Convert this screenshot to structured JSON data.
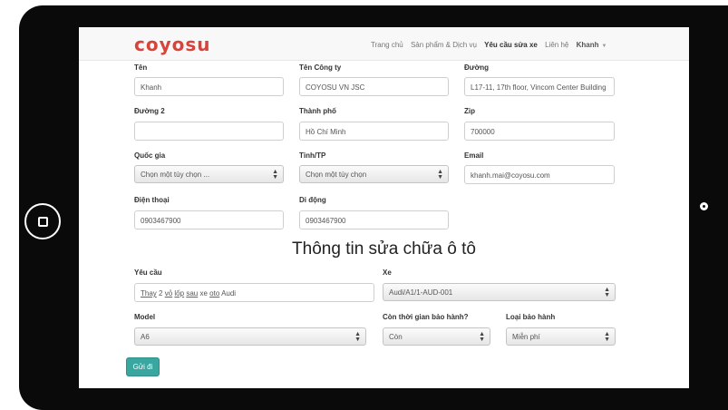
{
  "nav": {
    "logo": "coyosu",
    "links": [
      "Trang chủ",
      "Sản phẩm & Dịch vụ",
      "Yêu cầu sửa xe",
      "Liên hệ"
    ],
    "user": "Khanh"
  },
  "form": {
    "name_label": "Tên",
    "name_value": "Khanh",
    "company_label": "Tên Công ty",
    "company_value": "COYOSU VN JSC",
    "street_label": "Đường",
    "street_value": "L17-11, 17th floor, Vincom Center Building",
    "street2_label": "Đường 2",
    "street2_value": "",
    "city_label": "Thành phố",
    "city_value": "Hồ Chí Minh",
    "zip_label": "Zip",
    "zip_value": "700000",
    "country_label": "Quốc gia",
    "country_value": "Chọn một tùy chọn ...",
    "province_label": "Tỉnh/TP",
    "province_value": "Chọn một tùy chọn",
    "email_label": "Email",
    "email_value": "khanh.mai@coyosu.com",
    "phone_label": "Điện thoại",
    "phone_value": "0903467900",
    "mobile_label": "Di động",
    "mobile_value": "0903467900"
  },
  "repair": {
    "title": "Thông tin sửa chữa ô tô",
    "request_label": "Yêu cầu",
    "request_value": [
      "Thay",
      "2",
      "vỏ",
      "lốp",
      "sau",
      "xe",
      "oto",
      "Audi"
    ],
    "car_label": "Xe",
    "car_value": "Audi/A1/1-AUD-001",
    "model_label": "Model",
    "model_value": "A6",
    "warranty_left_label": "Còn thời gian bảo hành?",
    "warranty_left_value": "Còn",
    "warranty_type_label": "Loại bảo hành",
    "warranty_type_value": "Miễn phí",
    "submit_label": "Gửi đi"
  }
}
